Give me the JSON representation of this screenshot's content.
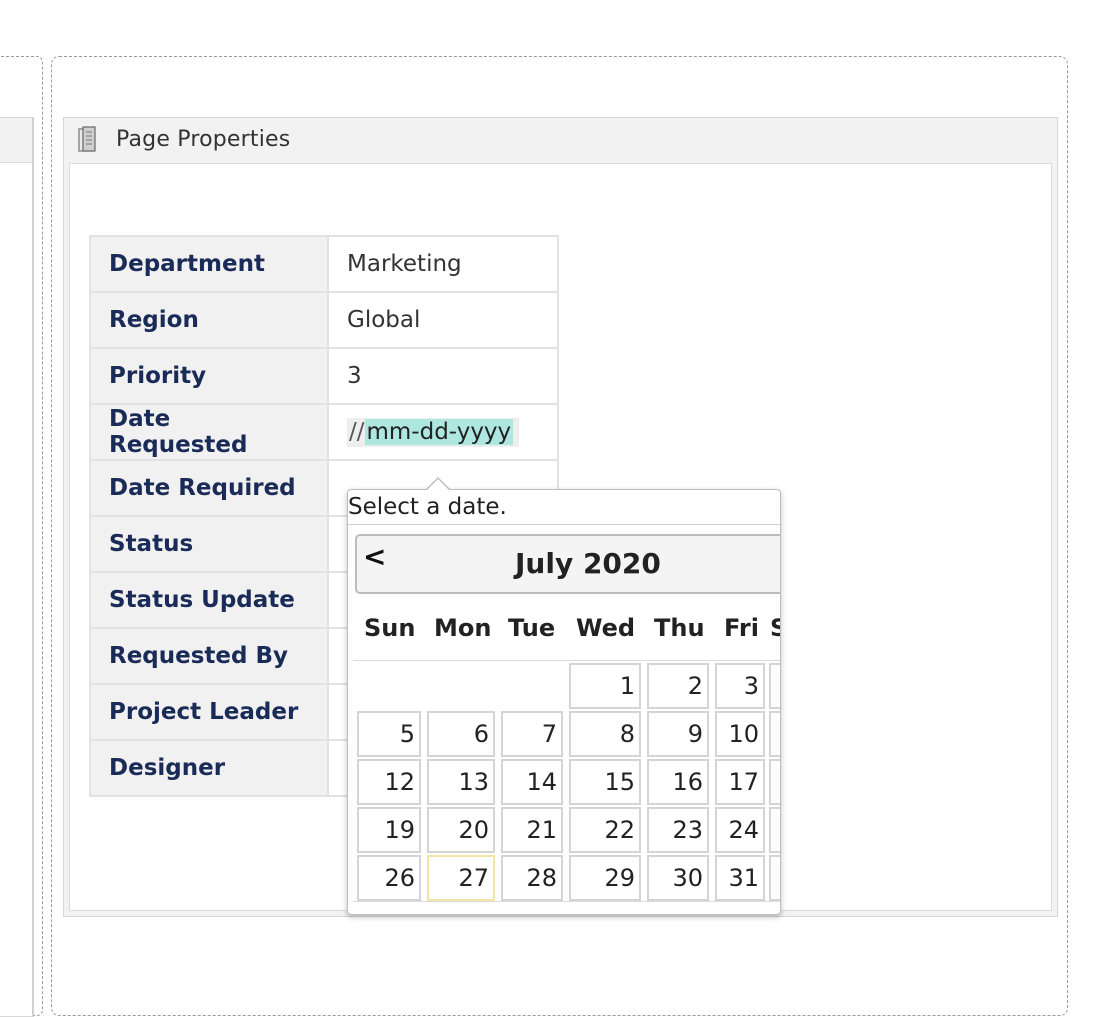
{
  "panel": {
    "title": "Page Properties",
    "icon": "page-icon"
  },
  "properties": [
    {
      "key": "Department",
      "value": "Marketing"
    },
    {
      "key": "Region",
      "value": "Global"
    },
    {
      "key": "Priority",
      "value": "3"
    },
    {
      "key": "Date Requested",
      "value": ""
    },
    {
      "key": "Date Required",
      "value": ""
    },
    {
      "key": "Status",
      "value": ""
    },
    {
      "key": "Status Update",
      "value": ""
    },
    {
      "key": "Requested By",
      "value": ""
    },
    {
      "key": "Project Leader",
      "value": ""
    },
    {
      "key": "Designer",
      "value": ""
    }
  ],
  "date_input": {
    "prefix": "//",
    "mask": "mm-dd-yyyy"
  },
  "datepicker": {
    "caption": "Select a date.",
    "prev_label": "<",
    "month_label": "July 2020",
    "weekdays": [
      "Sun",
      "Mon",
      "Tue",
      "Wed",
      "Thu",
      "Fri",
      "S"
    ],
    "weeks": [
      [
        "",
        "",
        "",
        "1",
        "2",
        "3",
        ""
      ],
      [
        "5",
        "6",
        "7",
        "8",
        "9",
        "10",
        ""
      ],
      [
        "12",
        "13",
        "14",
        "15",
        "16",
        "17",
        ""
      ],
      [
        "19",
        "20",
        "21",
        "22",
        "23",
        "24",
        ""
      ],
      [
        "26",
        "27",
        "28",
        "29",
        "30",
        "31",
        ""
      ]
    ],
    "highlighted_day": "27"
  },
  "colors": {
    "key_text": "#1a2b57",
    "mask_highlight": "#aee6e0",
    "today_border": "#f1e6a8"
  }
}
